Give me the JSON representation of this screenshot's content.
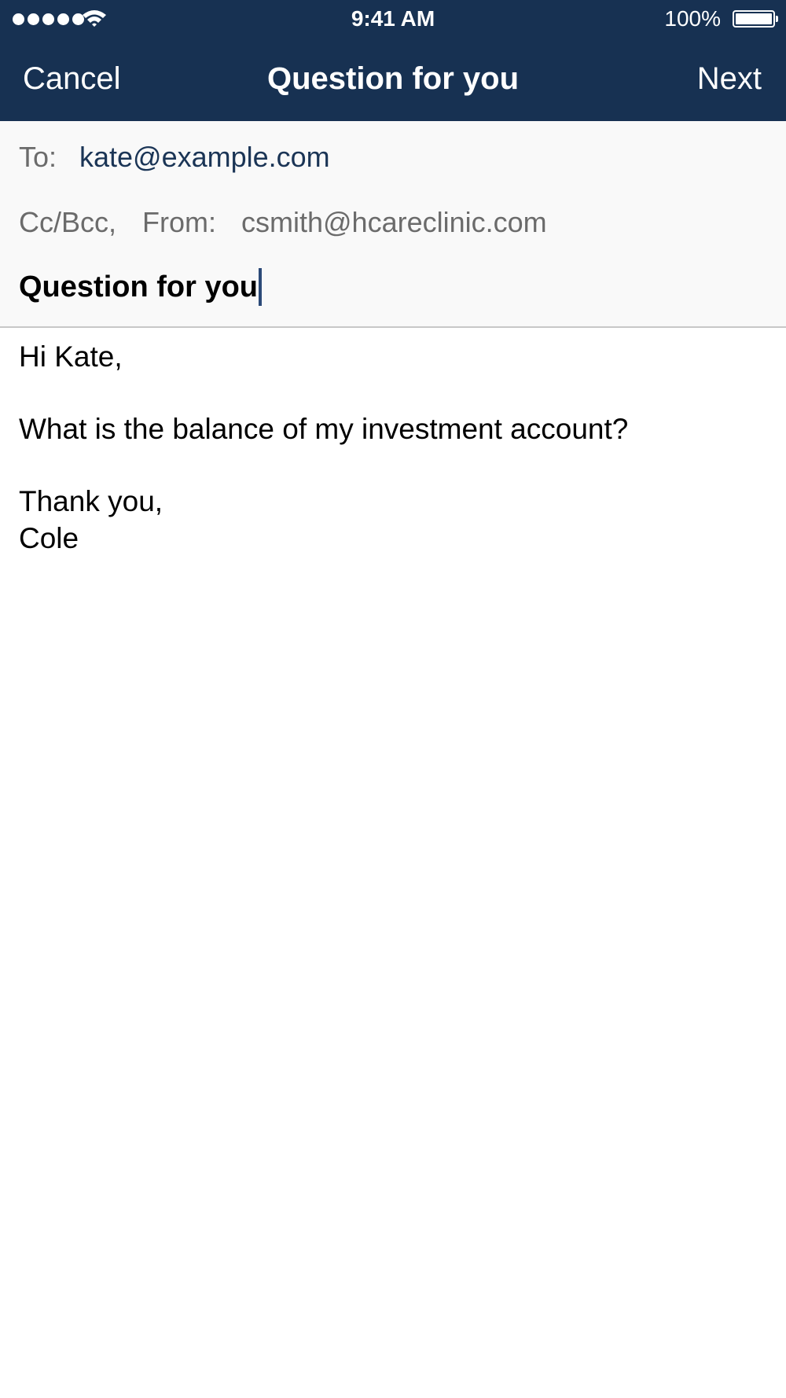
{
  "status_bar": {
    "time": "9:41 AM",
    "battery_percent": "100%",
    "signal_bars": 5,
    "battery_level": 1.0
  },
  "nav": {
    "cancel_label": "Cancel",
    "title": "Question for you",
    "next_label": "Next",
    "background_color": "#173152"
  },
  "compose": {
    "to_label": "To:",
    "to_value": "kate@example.com",
    "cc_label": "Cc/Bcc,",
    "from_label": "From:",
    "from_value": "csmith@hcareclinic.com",
    "subject": "Question for you",
    "body": {
      "greeting": "Hi Kate,",
      "question": "What is the balance of my investment account?",
      "closing": "Thank you,",
      "signature": "Cole"
    }
  }
}
